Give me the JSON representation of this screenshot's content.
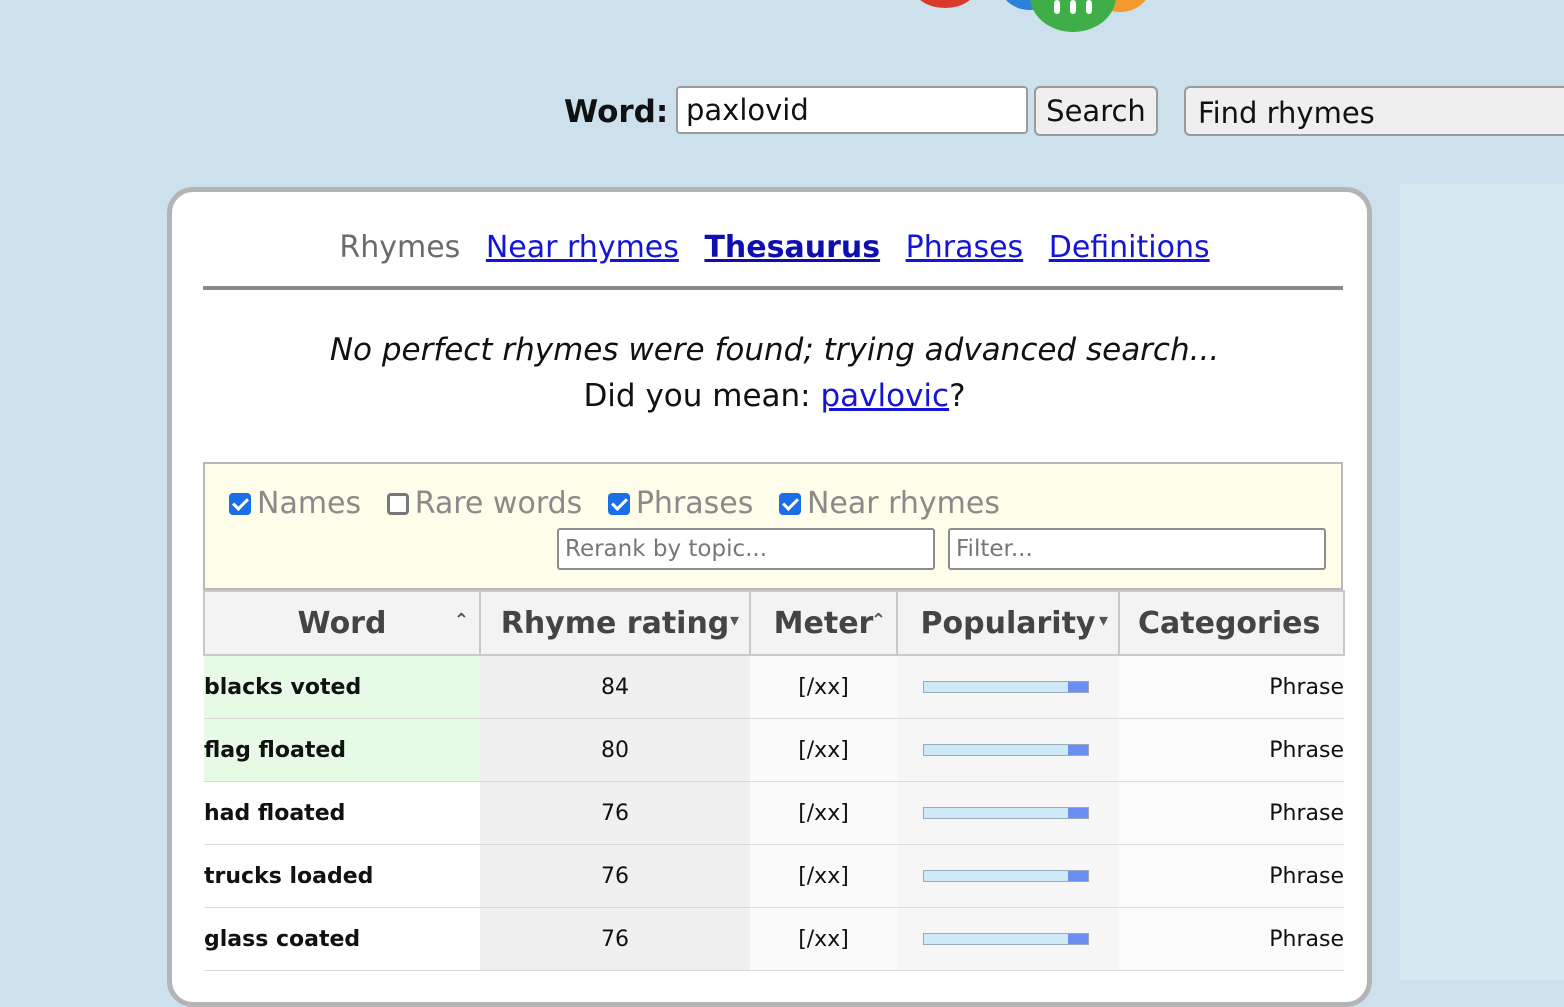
{
  "colors": {
    "background": "#cde1ec",
    "link": "#1515d8",
    "checkbox": "#1a6ee6",
    "highlight_row": "#e6fae6"
  },
  "search": {
    "label": "Word:",
    "value": "paxlovid",
    "button": "Search",
    "mode": "Find rhymes"
  },
  "tabs": {
    "current": "Rhymes",
    "links": [
      "Near rhymes",
      "Thesaurus",
      "Phrases",
      "Definitions"
    ]
  },
  "message": {
    "no_results": "No perfect rhymes were found; trying advanced search...",
    "did_you_mean_prefix": "Did you mean: ",
    "suggestion": "pavlovic",
    "suffix": "?"
  },
  "filters": {
    "checkboxes": [
      {
        "label": "Names",
        "checked": true
      },
      {
        "label": "Rare words",
        "checked": false
      },
      {
        "label": "Phrases",
        "checked": true
      },
      {
        "label": "Near rhymes",
        "checked": true
      }
    ],
    "rerank_placeholder": "Rerank by topic...",
    "filter_placeholder": "Filter..."
  },
  "table": {
    "headers": [
      "Word",
      "Rhyme rating",
      "Meter",
      "Popularity",
      "Categories"
    ],
    "sort_icons": [
      "chevron-up-icon",
      "chevron-down-icon",
      "chevron-up-icon",
      "chevron-down-icon"
    ],
    "rows": [
      {
        "word": "blacks voted",
        "rating": "84",
        "meter": "[/xx]",
        "popularity": 0.12,
        "category": "Phrase"
      },
      {
        "word": "flag floated",
        "rating": "80",
        "meter": "[/xx]",
        "popularity": 0.12,
        "category": "Phrase"
      },
      {
        "word": "had floated",
        "rating": "76",
        "meter": "[/xx]",
        "popularity": 0.12,
        "category": "Phrase"
      },
      {
        "word": "trucks loaded",
        "rating": "76",
        "meter": "[/xx]",
        "popularity": 0.12,
        "category": "Phrase"
      },
      {
        "word": "glass coated",
        "rating": "76",
        "meter": "[/xx]",
        "popularity": 0.12,
        "category": "Phrase"
      }
    ]
  }
}
